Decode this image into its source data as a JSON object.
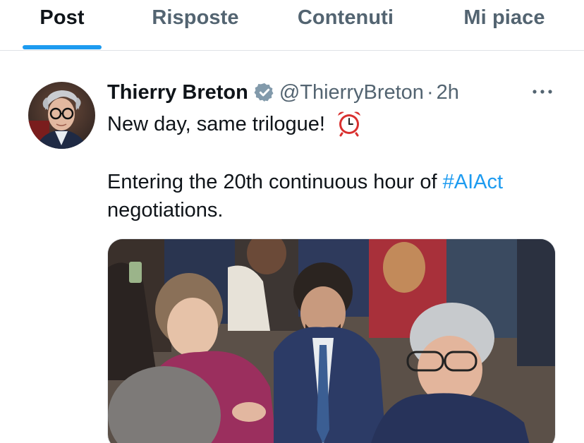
{
  "tabs": [
    {
      "label": "Post",
      "active": true
    },
    {
      "label": "Risposte",
      "active": false
    },
    {
      "label": "Contenuti",
      "active": false
    },
    {
      "label": "Mi piace",
      "active": false
    }
  ],
  "tweet": {
    "author_name": "Thierry Breton",
    "verified": true,
    "handle": "@ThierryBreton",
    "separator": "·",
    "time": "2h",
    "line1_text": "New day, same trilogue!",
    "line1_emoji": "alarm-clock-icon",
    "line2_text": "Entering the 20th continuous hour of ",
    "hashtag": "#AIAct",
    "line3_text": "negotiations.",
    "more_icon": "more-horizontal-icon",
    "media": "photo"
  },
  "colors": {
    "accent": "#1d9bf0",
    "text_primary": "#0f1419",
    "text_secondary": "#536471",
    "divider": "#dfe3e7",
    "verified_badge": "#829aab"
  }
}
